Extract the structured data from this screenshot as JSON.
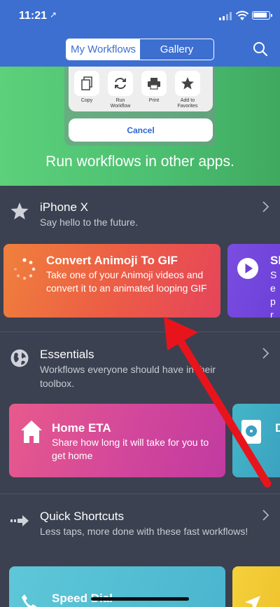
{
  "status_bar": {
    "time": "11:21",
    "location_glyph": "↗"
  },
  "header": {
    "tabs": [
      {
        "label": "My Workflows",
        "active": true
      },
      {
        "label": "Gallery",
        "active": false
      }
    ],
    "search_icon": "search-icon"
  },
  "banner": {
    "share_actions": [
      {
        "label": "Copy"
      },
      {
        "label": "Run Workflow"
      },
      {
        "label": "Print"
      },
      {
        "label": "Add to Favorites"
      }
    ],
    "cancel_label": "Cancel",
    "caption": "Run workflows in other apps."
  },
  "sections": [
    {
      "title": "iPhone X",
      "description": "Say hello to the future.",
      "cards": [
        {
          "title": "Convert Animoji To GIF",
          "description": "Take one of your Animoji videos and convert it to an animated looping GIF"
        },
        {
          "title": "Sh",
          "description": "Se pr fo"
        }
      ]
    },
    {
      "title": "Essentials",
      "description": "Workflows everyone should have in their toolbox.",
      "cards": [
        {
          "title": "Home ETA",
          "description": "Share how long it will take for you to get home"
        },
        {
          "title": "D",
          "description": ""
        }
      ]
    },
    {
      "title": "Quick Shortcuts",
      "description": "Less taps, more done with these fast workflows!",
      "cards": [
        {
          "title": "Speed Dial",
          "description": ""
        },
        {
          "title": "",
          "description": ""
        }
      ]
    }
  ],
  "colors": {
    "header_blue": "#3d6fd0",
    "background": "#3b4150",
    "banner_green": "#4bbe70",
    "annotation_arrow": "#e8141c"
  }
}
